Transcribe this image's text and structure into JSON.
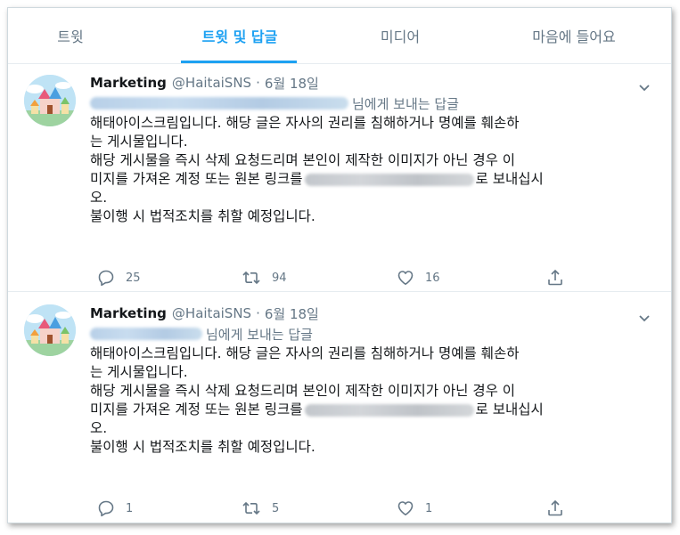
{
  "tabs": [
    {
      "label": "트윗",
      "active": false
    },
    {
      "label": "트윗 및 답글",
      "active": true
    },
    {
      "label": "미디어",
      "active": false
    },
    {
      "label": "마음에 들어요",
      "active": false
    }
  ],
  "accent_color": "#1da1f2",
  "tweets": [
    {
      "name": "Marketing",
      "handle": "@HaitaiSNS",
      "dot": "·",
      "date": "6월 18일",
      "reply_suffix": "님에게 보내는 답글",
      "line1": "해태아이스크림입니다. 해당 글은 자사의 권리를 침해하거나 명예를 훼손하",
      "line2": "는 게시물입니다.",
      "line3": "해당 게시물을 즉시 삭제 요청드리며 본인이 제작한 이미지가 아닌 경우 이",
      "line4a": "미지를 가져온 계정 또는 원본 링크를",
      "line4b": "로 보내십시",
      "line5": "오.",
      "line6": "불이행 시 법적조치를 취할 예정입니다.",
      "replies": "25",
      "retweets": "94",
      "likes": "16"
    },
    {
      "name": "Marketing",
      "handle": "@HaitaiSNS",
      "dot": "·",
      "date": "6월 18일",
      "reply_suffix": "님에게 보내는 답글",
      "line1": "해태아이스크림입니다. 해당 글은 자사의 권리를 침해하거나 명예를 훼손하",
      "line2": "는 게시물입니다.",
      "line3": "해당 게시물을 즉시 삭제 요청드리며 본인이 제작한 이미지가 아닌 경우 이",
      "line4a": "미지를 가져온 계정 또는 원본 링크를",
      "line4b": "로 보내십시",
      "line5": "오.",
      "line6": "불이행 시 법적조치를 취할 예정입니다.",
      "replies": "1",
      "retweets": "5",
      "likes": "1"
    }
  ]
}
